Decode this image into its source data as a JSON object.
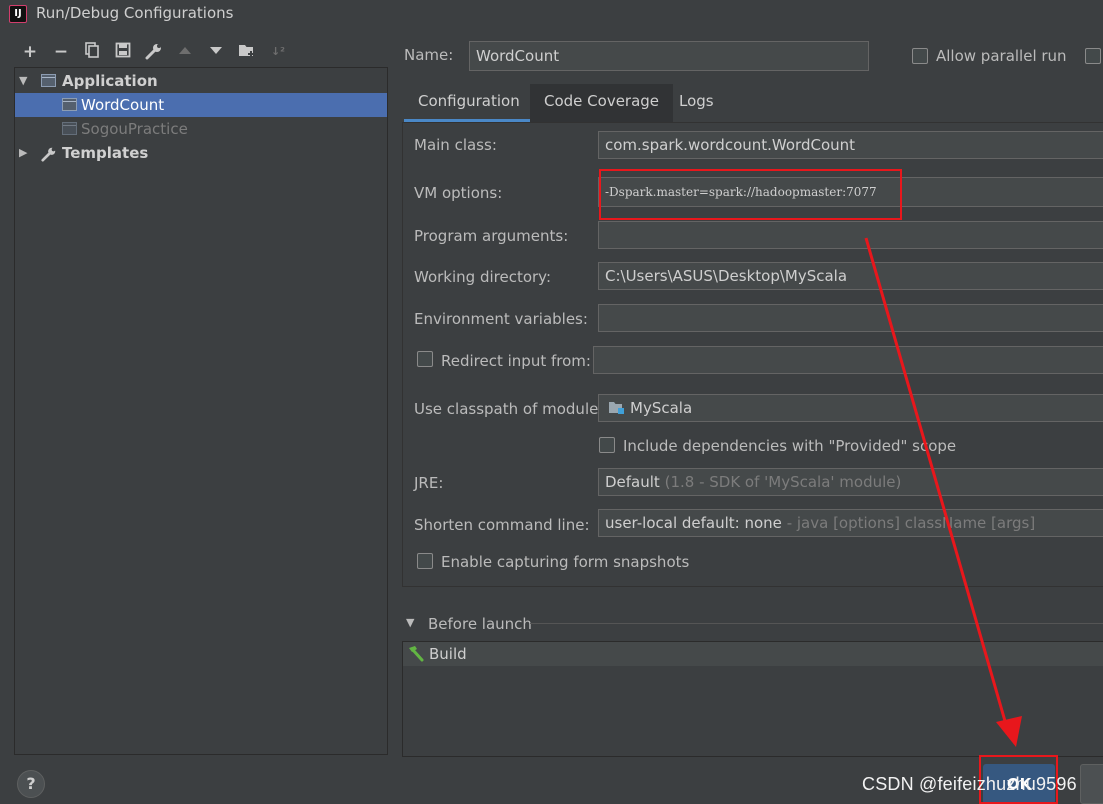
{
  "window": {
    "title": "Run/Debug Configurations",
    "logo_text": "IJ"
  },
  "toolbar": {
    "icons": [
      "plus-icon",
      "minus-icon",
      "copy-icon",
      "save-icon",
      "wrench-icon",
      "arrow-up-icon",
      "arrow-down-icon",
      "folder-add-icon",
      "sort-icon"
    ]
  },
  "tree": {
    "application_label": "Application",
    "items": [
      {
        "label": "WordCount"
      },
      {
        "label": "SogouPractice"
      }
    ],
    "templates_label": "Templates"
  },
  "header": {
    "name_label": "Name:",
    "name_value": "WordCount",
    "allow_parallel_label": "Allow parallel run"
  },
  "tabs": [
    {
      "label": "Configuration"
    },
    {
      "label": "Code Coverage"
    },
    {
      "label": "Logs"
    }
  ],
  "form": {
    "main_class_label": "Main class:",
    "main_class_value": "com.spark.wordcount.WordCount",
    "vm_options_label": "VM options:",
    "vm_options_value": "-Dspark.master=spark://hadoopmaster:7077",
    "program_args_label": "Program arguments:",
    "working_dir_label": "Working directory:",
    "working_dir_value": "C:\\Users\\ASUS\\Desktop\\MyScala",
    "env_vars_label": "Environment variables:",
    "redirect_label": "Redirect input from:",
    "classpath_label": "Use classpath of module:",
    "classpath_value": "MyScala",
    "include_deps_label": "Include dependencies with \"Provided\" scope",
    "jre_label": "JRE:",
    "jre_value": "Default",
    "jre_hint": "(1.8 - SDK of 'MyScala' module)",
    "shorten_label": "Shorten command line:",
    "shorten_value": "user-local default: none",
    "shorten_hint": "- java [options] className [args]",
    "snapshots_label": "Enable capturing form snapshots"
  },
  "before_launch": {
    "label": "Before launch",
    "items": [
      {
        "label": "Build"
      }
    ]
  },
  "footer": {
    "help_label": "?",
    "ok_label": "OK",
    "watermark": "CSDN @feifeizhuzhu9596"
  },
  "colors": {
    "background": "#3c3f41",
    "selection": "#4b6eaf",
    "annotation_red": "#e8171c",
    "ok_button": "#365880"
  }
}
